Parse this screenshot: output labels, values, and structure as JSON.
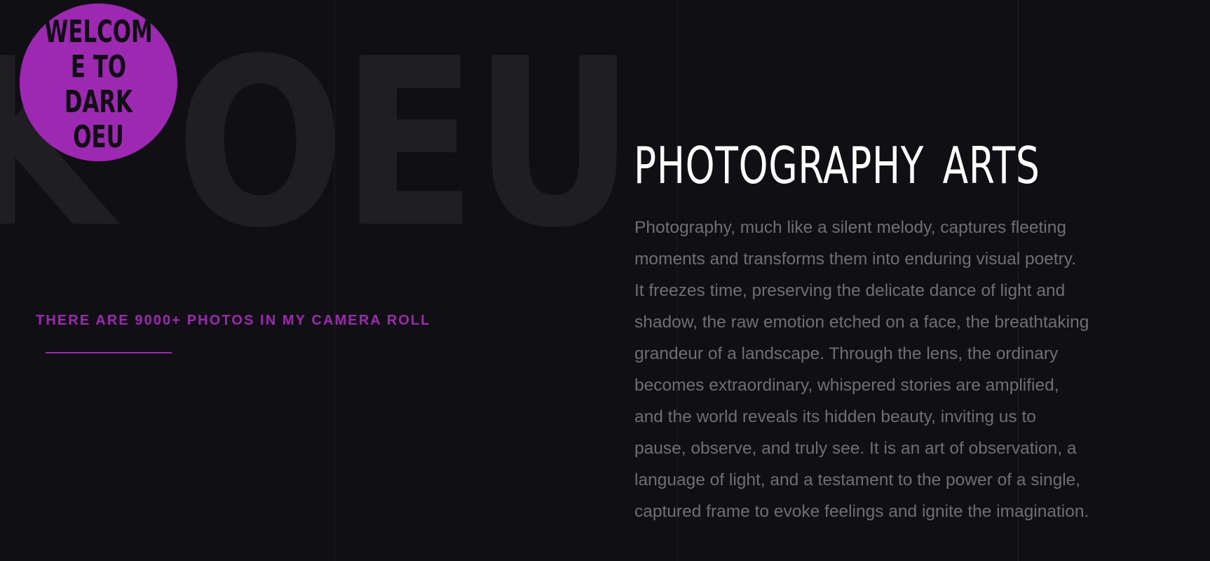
{
  "background_word": "K OEU",
  "badge": {
    "lines": [
      "WELCOM",
      "E TO",
      "DARK",
      "OEU"
    ]
  },
  "subtitle": "THERE ARE 9000+ PHOTOS IN MY CAMERA ROLL",
  "heading": "PHOTOGRAPHY ARTS",
  "body": "Photography, much like a silent melody, captures fleeting moments and transforms them into enduring visual poetry. It freezes time, preserving the delicate dance of light and shadow, the raw emotion etched on a face, the breathtaking grandeur of a landscape. Through the lens, the ordinary becomes extraordinary, whispered stories are amplified, and the world reveals its hidden beauty, inviting us to pause, observe, and truly see. It is an art of observation, a language of light, and a testament to the power of a single, captured frame to evoke feelings and ignite the imagination.",
  "colors": {
    "background": "#101014",
    "accent": "#9d28b1",
    "heading": "#ffffff",
    "body": "#6e6e74",
    "background_word": "#1f1f23"
  }
}
